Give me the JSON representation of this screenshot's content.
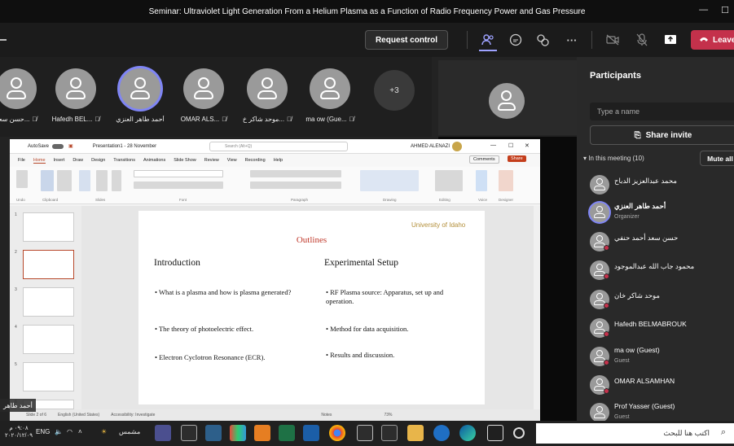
{
  "window": {
    "title": "Seminar: Ultraviolet Light Generation From a Helium Plasma as a Function of Radio Frequency Power and Gas Pressure"
  },
  "toolbar": {
    "request_control": "Request control",
    "leave": "Leave"
  },
  "gallery": {
    "tiles": [
      {
        "name": "حسن سعد..."
      },
      {
        "name": "Hafedh BEL..."
      },
      {
        "name": "أحمد طاهر العنزي"
      },
      {
        "name": "OMAR ALS..."
      },
      {
        "name": "موحد شاكر خ..."
      },
      {
        "name": "ma ow (Gue..."
      }
    ],
    "more": "+3"
  },
  "shared_name_tag": "أحمد طاهر",
  "ppt": {
    "autosave": "AutoSave",
    "filename": "Presentation1 - 28 November",
    "search": "Search (Alt+Q)",
    "user": "AHMED ALENAZI",
    "comments": "Comments",
    "share": "Share",
    "tabs": [
      "File",
      "Home",
      "Insert",
      "Draw",
      "Design",
      "Transitions",
      "Animations",
      "Slide Show",
      "Review",
      "View",
      "Recording",
      "Help"
    ],
    "ribbon_groups": [
      "Undo",
      "Clipboard",
      "Slides",
      "Font",
      "Paragraph",
      "Drawing",
      "Editing",
      "Voice",
      "Designer"
    ],
    "status": [
      "Slide 2 of 6",
      "English (United States)",
      "Accessibility: Investigate",
      "Notes",
      "73%"
    ],
    "slide": {
      "title": "Outlines",
      "logo": "University of Idaho",
      "left_heading": "Introduction",
      "right_heading": "Experimental Setup",
      "left_bullets": [
        "What is a plasma and how is plasma generated?",
        "The theory of photoelectric effect.",
        "Electron Cyclotron Resonance (ECR)."
      ],
      "right_bullets": [
        "RF Plasma source: Apparatus, set up and operation.",
        "Method for data acquisition.",
        "Results and discussion."
      ]
    },
    "thumb_numbers": [
      "1",
      "2",
      "3",
      "4",
      "5",
      "6"
    ]
  },
  "panel": {
    "title": "Participants",
    "type_placeholder": "Type a name",
    "share_invite": "Share invite",
    "in_meeting": "In this meeting (10)",
    "mute_all": "Mute all",
    "people": [
      {
        "name": "محمد عبدالعزيز الدباح",
        "role": ""
      },
      {
        "name": "أحمد طاهر العنزي",
        "role": "Organizer"
      },
      {
        "name": "حسن سعد أحمد حنفي",
        "role": ""
      },
      {
        "name": "محمود جاب الله عبدالموجود",
        "role": ""
      },
      {
        "name": "موحد شاكر خان",
        "role": ""
      },
      {
        "name": "Hafedh BELMABROUK",
        "role": ""
      },
      {
        "name": "ma ow (Guest)",
        "role": "Guest"
      },
      {
        "name": "OMAR ALSAMHAN",
        "role": ""
      },
      {
        "name": "Prof Yasser (Guest)",
        "role": "Guest"
      }
    ]
  },
  "taskbar": {
    "time": "٠٩:٠٨ م",
    "date": "٢٠٢٠/١٢/٠٩",
    "lang": "ENG",
    "weather": "مشمس",
    "search": "اكتب هنا للبحث"
  }
}
